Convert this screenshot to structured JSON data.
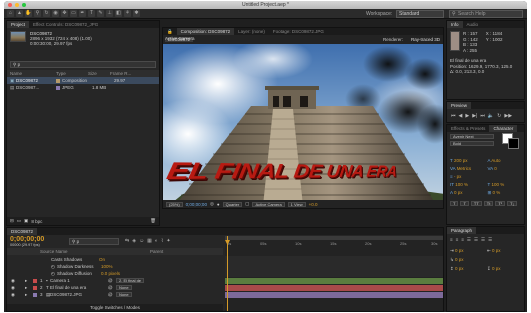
{
  "app": {
    "window_title": "Untitled Project.aep *",
    "workspace_label": "Workspace:",
    "workspace_value": "Standard",
    "search_placeholder": "Search Help"
  },
  "project_panel": {
    "tabs": [
      "Project",
      "Effect Controls: DSC09872_JPG"
    ],
    "item_name": "DSC09872",
    "item_info": [
      "2896 x 1932 (724 x 408) (1.00)",
      "0:00:30:00, 29.97 fps"
    ],
    "search_value": "p",
    "columns": [
      "Name",
      "Type",
      "Size",
      "Frame R..."
    ],
    "rows": [
      {
        "name": "DSC09872",
        "type": "Composition",
        "size": "",
        "frame_rate": "29.97"
      },
      {
        "name": "DSC0987...",
        "type": "JPEG",
        "size": "1.8 MB",
        "frame_rate": ""
      }
    ],
    "bpc": "8 bpc"
  },
  "composition_panel": {
    "tabs": [
      "Composition: DSC09872",
      "Layer: (none)",
      "Footage: DSC09872.JPG"
    ],
    "comp_tab": "DSC09872",
    "renderer_label": "Renderer:",
    "renderer_value": "Ray-traced 3D",
    "active_camera": "Active Camera",
    "headline": "EL FINAL DE UNA ERA",
    "zoom": "(25%)",
    "timecode": "0;00;00;00",
    "quality": "Quarter",
    "view": "Active Camera",
    "views": "1 View",
    "exposure": "+0.0"
  },
  "info_panel": {
    "tabs": [
      "Info",
      "Audio"
    ],
    "rgba": [
      "R : 157",
      "G : 142",
      "B : 133",
      "A : 255"
    ],
    "xy": [
      "X : 1184",
      "Y : 1002"
    ],
    "layer_name": "El final de una era",
    "position": "Position: 1629.9, 1770.3, 125.0",
    "delta": "Δ: 0.0, 213.3, 0.0"
  },
  "preview_panel": {
    "tabs": [
      "Preview"
    ]
  },
  "character_panel": {
    "tabs": [
      "Effects & Presets",
      "Character"
    ],
    "font": "Avenir Next",
    "style": "Bold",
    "size": "200 px",
    "leading": "Auto",
    "kerning": "Metrics",
    "tracking": "0",
    "stroke": "- px",
    "scale_v": "100 %",
    "scale_h": "100 %",
    "baseline": "0 px",
    "tsume": "0 %",
    "colors": {
      "fill": "#ffffff",
      "stroke": "#000000",
      "headline": "#b81a12",
      "accent": "#d49a28",
      "timeline_green": "#5a7d3f",
      "timeline_red": "#a84a4a"
    }
  },
  "paragraph_panel": {
    "tabs": [
      "Paragraph"
    ],
    "indents": [
      "0 px",
      "0 px",
      "0 px",
      "0 px",
      "0 px"
    ]
  },
  "timeline": {
    "comp_tab": "DSC09872",
    "timecode": "0;00;00;00",
    "timecode_sub": "00000 (29.97 fps)",
    "search_value": "p",
    "columns": [
      "Source Name",
      "Parent"
    ],
    "properties": [
      {
        "name": "Casts Shadows",
        "value": "On"
      },
      {
        "name": "Shadow Darkness",
        "value": "100%"
      },
      {
        "name": "Shadow Diffusion",
        "value": "0.0 pixels"
      }
    ],
    "layers": [
      {
        "num": "1",
        "name": "Camera 1",
        "parent": "2. El final de"
      },
      {
        "num": "2",
        "name": "El final de una era",
        "parent": "None"
      },
      {
        "num": "3",
        "name": "DSC09872.JPG",
        "parent": "None"
      }
    ],
    "ruler": [
      "0s",
      "05s",
      "10s",
      "15s",
      "20s",
      "25s",
      "30s"
    ],
    "toggle_label": "Toggle Switches / Modes"
  }
}
